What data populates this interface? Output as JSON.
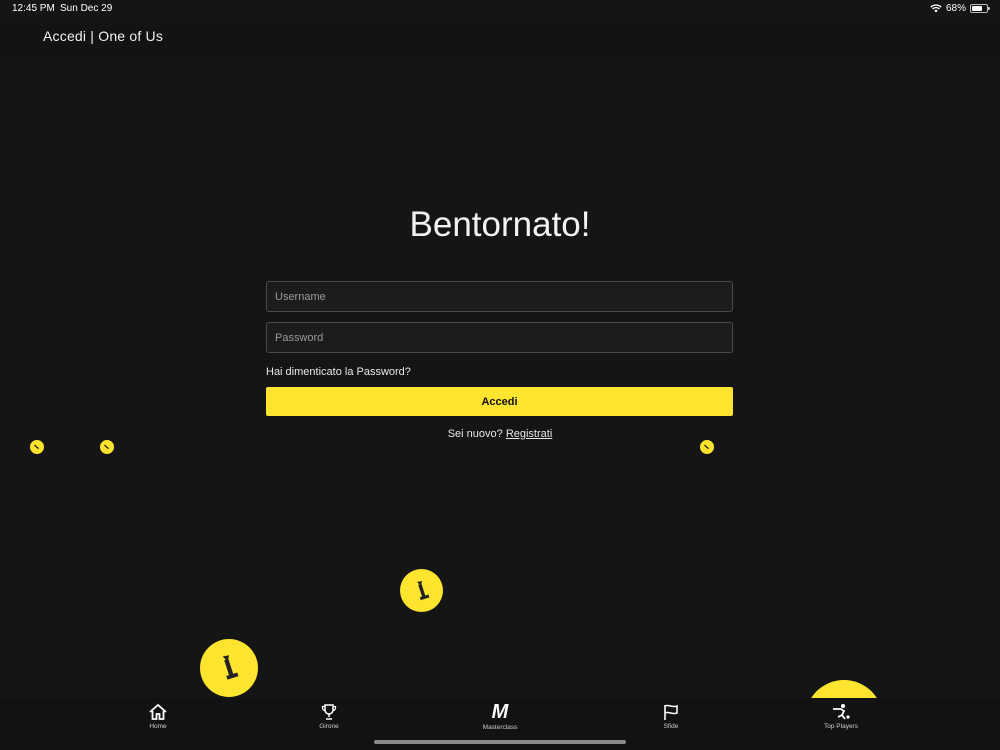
{
  "status_bar": {
    "time": "12:45 PM",
    "date": "Sun Dec 29",
    "battery": "68%",
    "battery_level": 0.68
  },
  "header": {
    "title": "Accedi | One of Us"
  },
  "login": {
    "title": "Bentornato!",
    "username_placeholder": "Username",
    "password_placeholder": "Password",
    "forgot_password": "Hai dimenticato la Password?",
    "submit_label": "Accedi",
    "signup_prompt": "Sei nuovo?",
    "signup_link": "Registrati"
  },
  "colors": {
    "background": "#151515",
    "accent": "#fde42f",
    "field_background": "#1c1c1c"
  },
  "decorations": {
    "badge_icon": "torch-icon"
  },
  "tab_bar": {
    "items": [
      {
        "label": "Home",
        "icon": "home-icon"
      },
      {
        "label": "Girone",
        "icon": "trophy-icon"
      },
      {
        "label": "Masterclass",
        "icon": "masterclass-logo-icon",
        "glyph": "M"
      },
      {
        "label": "Sfide",
        "icon": "flag-icon"
      },
      {
        "label": "Top Players",
        "icon": "player-kick-icon"
      }
    ]
  }
}
